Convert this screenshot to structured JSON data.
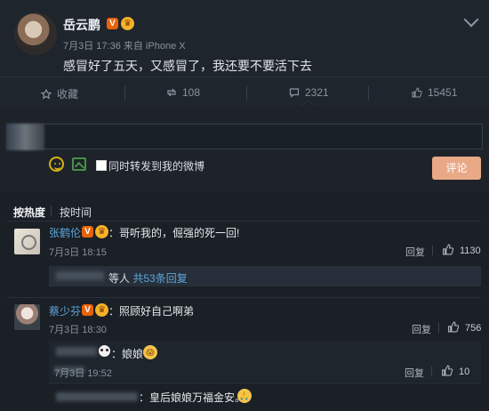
{
  "post": {
    "author": "岳云鹏",
    "verified_badge": "V",
    "crown_badge": "♛",
    "meta": "7月3日 17:36 来自 iPhone X",
    "content": "感冒好了五天，又感冒了，我还要不要活下去",
    "menu_icon": "chevron-down-icon"
  },
  "actions": {
    "favorite": "收藏",
    "repost": "108",
    "comment": "2321",
    "like": "15451"
  },
  "composer": {
    "repost_label": "同时转发到我的微博",
    "submit_label": "评论"
  },
  "sort": {
    "hot": "按热度",
    "time": "按时间"
  },
  "comments": [
    {
      "name": "张鹤伦",
      "text": "：哥听我的，倔强的死一回!",
      "time": "7月3日 18:15",
      "reply": "回复",
      "likes": "1130"
    },
    {
      "name": "蔡少芬",
      "text": "：照顾好自己啊弟",
      "time": "7月3日 18:30",
      "reply": "回复",
      "likes": "756"
    }
  ],
  "subthread": {
    "summary_prefix": "等人",
    "summary_link": "共53条回复"
  },
  "replies": [
    {
      "text": "：娘娘",
      "time": "7月3日 19:52",
      "reply": "回复",
      "likes": "10",
      "emoji": "😱"
    },
    {
      "text": "：皇后娘娘万福金安。",
      "emoji": "🙏"
    }
  ],
  "colors": {
    "background": "#1b2026",
    "link": "#5ea4d8",
    "submit_button": "#e9a987"
  }
}
